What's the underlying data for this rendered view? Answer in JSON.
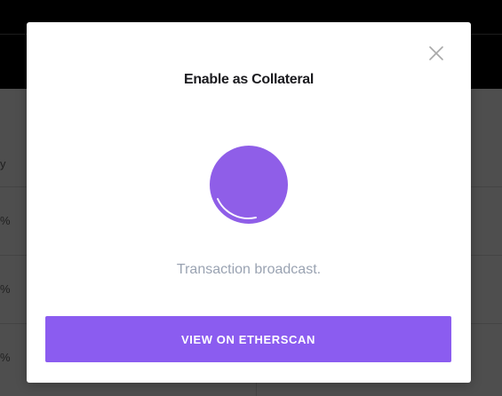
{
  "modal": {
    "title": "Enable as Collateral",
    "status_text": "Transaction broadcast.",
    "action_label": "VIEW ON ETHERSCAN",
    "close_icon": "close-icon",
    "spinner_icon": "loading-spinner-icon"
  },
  "background": {
    "row_glyphs": [
      "y",
      "%",
      "%",
      "%"
    ]
  },
  "colors": {
    "accent": "#8b5cf0",
    "spinner": "#8f5ee8",
    "status_text": "#9aa3b2",
    "title": "#1b1b1f",
    "overlay": "#4e4e4e"
  }
}
